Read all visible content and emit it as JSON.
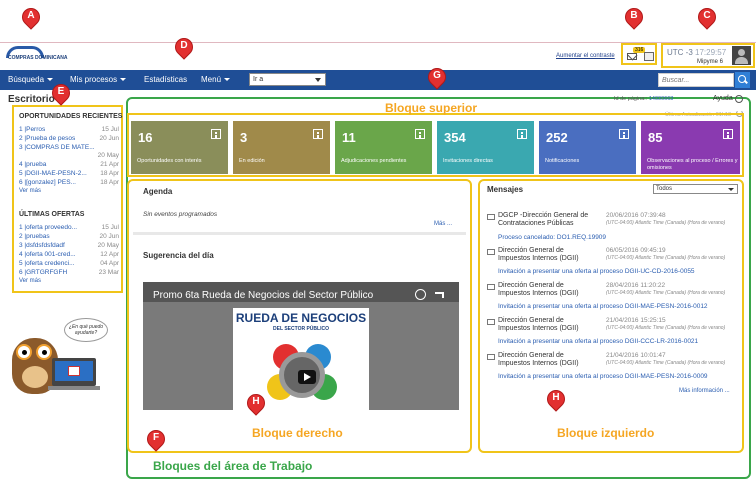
{
  "header": {
    "logo_text": "COMPRAS DOMINICANA",
    "contrast_link": "Aumentar el contraste",
    "mail_count": "316",
    "utc_label": "UTC -3",
    "time": "17:29:57",
    "user": "Mipyme 6"
  },
  "nav": {
    "items": [
      "Búsqueda",
      "Mis procesos",
      "Estadísticas",
      "Menú"
    ],
    "select_value": "Ir a",
    "search_placeholder": "Buscar..."
  },
  "sidebar": {
    "title": "Escritorio",
    "opportunities_title": "OPORTUNIDADES RECIENTES",
    "opportunities": [
      {
        "label": "1 |Perros",
        "date": "15 Jul"
      },
      {
        "label": "2 |Prueba de pesos",
        "date": "20 Jun"
      },
      {
        "label": "3 |COMPRAS DE MATE...",
        "date": "20 May"
      },
      {
        "label": "4 |prueba",
        "date": "21 Apr"
      },
      {
        "label": "5 |DGII-MAE-PESN-2...",
        "date": "18 Apr"
      },
      {
        "label": "6 |[gonzalez] PES...",
        "date": "18 Apr"
      }
    ],
    "opportunities_more": "Ver más",
    "offers_title": "ÚLTIMAS OFERTAS",
    "offers": [
      {
        "label": "1 |oferta proveedo...",
        "date": "15 Jul"
      },
      {
        "label": "2 |pruebas",
        "date": "20 Jun"
      },
      {
        "label": "3 |dsfdsfdsfdadf",
        "date": "20 May"
      },
      {
        "label": "4 |oferta 001-cred...",
        "date": "12 Apr"
      },
      {
        "label": "5 |oferta credenci...",
        "date": "04 Apr"
      },
      {
        "label": "6 |GRTGRFGFH",
        "date": "23 Mar"
      }
    ],
    "offers_more": "Ver más",
    "owl_speech": "¿En qué puedo ayudarte?"
  },
  "work": {
    "page_id_label": "Id de página::",
    "page_id": "14000663",
    "help": "Ayuda",
    "last_update": "Última Actualización 01h13"
  },
  "tiles": [
    {
      "num": "16",
      "label": "Oportunidades con interés",
      "color": "#8a8e5a"
    },
    {
      "num": "3",
      "label": "En edición",
      "color": "#a08a4a"
    },
    {
      "num": "11",
      "label": "Adjudicaciones pendientes",
      "color": "#6aa64a"
    },
    {
      "num": "354",
      "label": "Invitaciones directas",
      "color": "#3aa8b0"
    },
    {
      "num": "252",
      "label": "Notificaciones",
      "color": "#4a6ec0"
    },
    {
      "num": "85",
      "label": "Observaciones al proceso / Errores y omisiones",
      "color": "#8a3ab0"
    }
  ],
  "agenda": {
    "title": "Agenda",
    "empty": "Sin eventos programados",
    "more": "Más ..."
  },
  "suggestion": {
    "title": "Sugerencia del día",
    "video_title": "Promo 6ta Rueda de Negocios del Sector Público",
    "rueda_title": "RUEDA DE NEGOCIOS",
    "rueda_sub": "DEL SECTOR PÚBLICO"
  },
  "messages": {
    "title": "Mensajes",
    "filter": "Todos",
    "items": [
      {
        "sender": "DGCP -Dirección General de Contrataciones Públicas",
        "date": "20/06/2016 07:39:48",
        "tz": "(UTC-04:00) Atlantic Time (Canada) (Hora de verano)",
        "link": "Proceso cancelado: DO1.REQ.19909"
      },
      {
        "sender": "Dirección General de Impuestos Internos (DGII)",
        "date": "06/05/2016 09:45:19",
        "tz": "(UTC-04:00) Atlantic Time (Canada) (Hora de verano)",
        "link": "Invitación a presentar una oferta al proceso DGII-UC-CD-2016-0055"
      },
      {
        "sender": "Dirección General de Impuestos Internos (DGII)",
        "date": "28/04/2016 11:20:22",
        "tz": "(UTC-04:00) Atlantic Time (Canada) (Hora de verano)",
        "link": "Invitación a presentar una oferta al proceso DGII-MAE-PESN-2016-0012"
      },
      {
        "sender": "Dirección General de Impuestos Internos (DGII)",
        "date": "21/04/2016 15:25:15",
        "tz": "(UTC-04:00) Atlantic Time (Canada) (Hora de verano)",
        "link": "Invitación a presentar una oferta al proceso DGII-CCC-LR-2016-0021"
      },
      {
        "sender": "Dirección General de Impuestos Internos (DGII)",
        "date": "21/04/2016 10:01:47",
        "tz": "(UTC-04:00) Atlantic Time (Canada) (Hora de verano)",
        "link": "Invitación a presentar una oferta al proceso DGII-MAE-PESN-2016-0009"
      }
    ],
    "more": "Más información ..."
  },
  "annotations": {
    "markers": [
      "A",
      "B",
      "C",
      "D",
      "E",
      "G",
      "H",
      "H",
      "F"
    ],
    "upper": "Bloque superior",
    "right": "Bloque derecho",
    "left": "Bloque izquierdo",
    "work": "Bloques del área de Trabajo"
  }
}
